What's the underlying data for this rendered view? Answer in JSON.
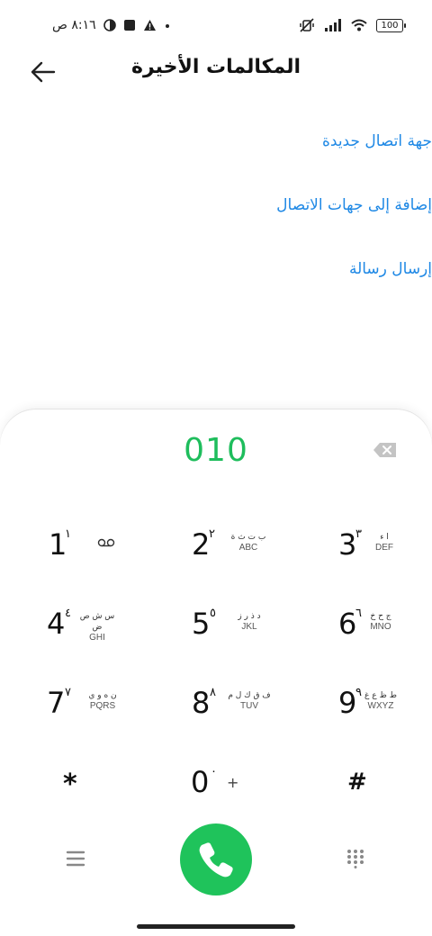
{
  "status_bar": {
    "time": "٨:١٦ ص",
    "battery": "100",
    "icons": [
      "theme-circle-icon",
      "square-app-icon",
      "warning-icon",
      "dot-icon",
      "mute-vibrate-icon",
      "signal-icon",
      "wifi-icon",
      "battery-icon"
    ]
  },
  "header": {
    "title": "المكالمات الأخيرة",
    "back_icon": "arrow-left-icon"
  },
  "actions": [
    {
      "label": "جهة اتصال جديدة"
    },
    {
      "label": "إضافة إلى جهات الاتصال"
    },
    {
      "label": "إرسال رسالة"
    }
  ],
  "dialer": {
    "number": "010",
    "accent": "#1ebd5c",
    "link_color": "#1e88e5",
    "keys": [
      {
        "digit": "1",
        "arabic": "١",
        "letters_ar": "",
        "letters_en": "",
        "icon": "voicemail-icon"
      },
      {
        "digit": "2",
        "arabic": "٢",
        "letters_ar": "ب ت ث ة",
        "letters_en": "ABC"
      },
      {
        "digit": "3",
        "arabic": "٣",
        "letters_ar": "ا ء",
        "letters_en": "DEF"
      },
      {
        "digit": "4",
        "arabic": "٤",
        "letters_ar": "س ش ص ض",
        "letters_en": "GHI"
      },
      {
        "digit": "5",
        "arabic": "٥",
        "letters_ar": "د ذ ر ز",
        "letters_en": "JKL"
      },
      {
        "digit": "6",
        "arabic": "٦",
        "letters_ar": "ج ح خ",
        "letters_en": "MNO"
      },
      {
        "digit": "7",
        "arabic": "٧",
        "letters_ar": "ن ه و ي",
        "letters_en": "PQRS"
      },
      {
        "digit": "8",
        "arabic": "٨",
        "letters_ar": "ف ق ك ل م",
        "letters_en": "TUV"
      },
      {
        "digit": "9",
        "arabic": "٩",
        "letters_ar": "ط ظ ع غ",
        "letters_en": "WXYZ"
      },
      {
        "digit": "*"
      },
      {
        "digit": "0",
        "arabic": "٠",
        "letters_en": "+"
      },
      {
        "digit": "#"
      }
    ]
  },
  "bottom": {
    "menu_icon": "menu-icon",
    "call_icon": "phone-icon",
    "keypad_icon": "dialpad-grid-icon"
  }
}
